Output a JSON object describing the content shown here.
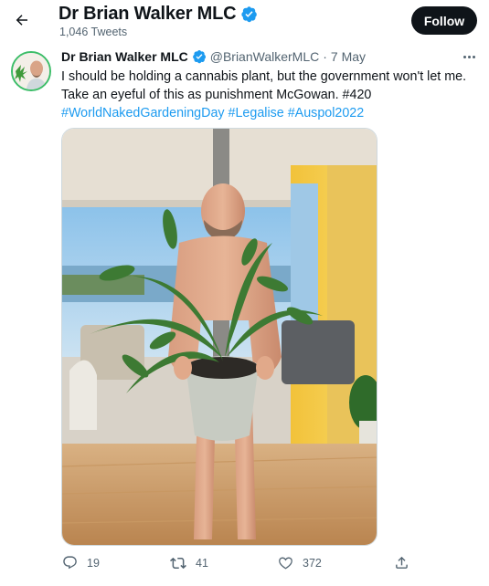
{
  "header": {
    "display_name": "Dr Brian Walker MLC",
    "tweet_count": "1,046 Tweets",
    "follow_label": "Follow"
  },
  "tweet": {
    "author_name": "Dr Brian Walker MLC",
    "handle": "@BrianWalkerMLC",
    "separator": "·",
    "date": "7 May",
    "text_plain": "I should be holding a cannabis plant, but the government won't let me. Take an eyeful of this as punishment McGowan. #420",
    "hashtags": [
      "#WorldNakedGardeningDay",
      "#Legalise",
      "#Auspol2022"
    ],
    "photo_description_icon": "photo"
  },
  "actions": {
    "reply_count": "19",
    "retweet_count": "41",
    "like_count": "372"
  },
  "colors": {
    "accent": "#1d9bf0",
    "text": "#0f1419",
    "muted": "#536471",
    "follow_bg": "#0f1419",
    "verified": "#1d9bf0"
  },
  "icons": [
    "back-arrow-icon",
    "verified-badge-icon",
    "more-icon",
    "reply-icon",
    "retweet-icon",
    "like-icon",
    "share-icon"
  ]
}
